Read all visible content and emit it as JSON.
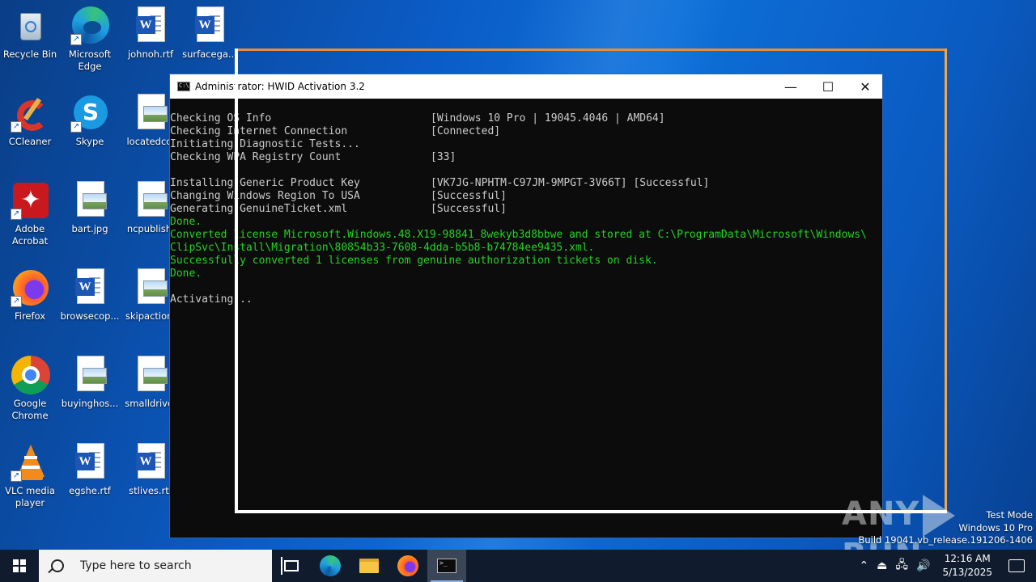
{
  "desktop": {
    "icons": [
      {
        "label": "Recycle Bin",
        "icon": "recycle-bin-icon"
      },
      {
        "label": "Microsoft Edge",
        "icon": "edge-icon"
      },
      {
        "label": "johnoh.rtf",
        "icon": "word-document-icon"
      },
      {
        "label": "surfacega...",
        "icon": "word-document-icon"
      },
      {
        "label": "CCleaner",
        "icon": "ccleaner-icon"
      },
      {
        "label": "Skype",
        "icon": "skype-icon"
      },
      {
        "label": "locatedcol",
        "icon": "image-file-icon"
      },
      {
        "label": "Adobe Acrobat",
        "icon": "acrobat-icon"
      },
      {
        "label": "bart.jpg",
        "icon": "image-file-icon"
      },
      {
        "label": "ncpublishi",
        "icon": "image-file-icon"
      },
      {
        "label": "Firefox",
        "icon": "firefox-icon"
      },
      {
        "label": "browsecop...",
        "icon": "word-document-icon"
      },
      {
        "label": "skipaction.",
        "icon": "image-file-icon"
      },
      {
        "label": "Google Chrome",
        "icon": "chrome-icon"
      },
      {
        "label": "buyinghos...",
        "icon": "image-file-icon"
      },
      {
        "label": "smalldrive.",
        "icon": "image-file-icon"
      },
      {
        "label": "VLC media player",
        "icon": "vlc-icon"
      },
      {
        "label": "egshe.rtf",
        "icon": "word-document-icon"
      },
      {
        "label": "stlives.rtf",
        "icon": "word-document-icon"
      }
    ]
  },
  "window": {
    "title": "Administrator:  HWID Activation 3.2",
    "icon": "cmd-icon",
    "minimize": "—",
    "maximize": "☐",
    "close": "✕"
  },
  "console": {
    "lines": [
      {
        "left": "Checking OS Info",
        "right": "[Windows 10 Pro | 19045.4046 | AMD64]",
        "color": "default"
      },
      {
        "left": "Checking Internet Connection",
        "right": "[Connected]",
        "color": "default"
      },
      {
        "left": "Initiating Diagnostic Tests...",
        "right": "",
        "color": "default"
      },
      {
        "left": "Checking WPA Registry Count",
        "right": "[33]",
        "color": "default"
      },
      {
        "left": "",
        "right": "",
        "color": "default"
      },
      {
        "left": "Installing Generic Product Key",
        "right": "[VK7JG-NPHTM-C97JM-9MPGT-3V66T] [Successful]",
        "color": "default"
      },
      {
        "left": "Changing Windows Region To USA",
        "right": "[Successful]",
        "color": "default"
      },
      {
        "left": "Generating GenuineTicket.xml",
        "right": "[Successful]",
        "color": "default"
      },
      {
        "left": "Done.",
        "right": "",
        "color": "green"
      },
      {
        "left": "Converted license Microsoft.Windows.48.X19-98841_8wekyb3d8bbwe and stored at C:\\ProgramData\\Microsoft\\Windows\\",
        "right": "",
        "color": "green"
      },
      {
        "left": "ClipSvc\\Install\\Migration\\80854b33-7608-4dda-b5b8-b74784ee9435.xml.",
        "right": "",
        "color": "green"
      },
      {
        "left": "Successfully converted 1 licenses from genuine authorization tickets on disk.",
        "right": "",
        "color": "green"
      },
      {
        "left": "Done.",
        "right": "",
        "color": "green"
      },
      {
        "left": "",
        "right": "",
        "color": "default"
      },
      {
        "left": "Activating...",
        "right": "",
        "color": "default"
      }
    ],
    "default_color": "#cccccc",
    "green_color": "#23d323"
  },
  "watermark": {
    "left": "ANY",
    "right": "RUN"
  },
  "os_info": {
    "line1": "Test Mode",
    "line2": "Windows 10 Pro",
    "line3": "Build 19041.vb_release.191206-1406"
  },
  "taskbar": {
    "search_placeholder": "Type here to search",
    "pinned": [
      {
        "name": "task-view-icon"
      },
      {
        "name": "edge-icon"
      },
      {
        "name": "file-explorer-icon"
      },
      {
        "name": "firefox-icon"
      },
      {
        "name": "cmd-icon"
      }
    ],
    "time": "12:16 AM",
    "date": "5/13/2025"
  }
}
